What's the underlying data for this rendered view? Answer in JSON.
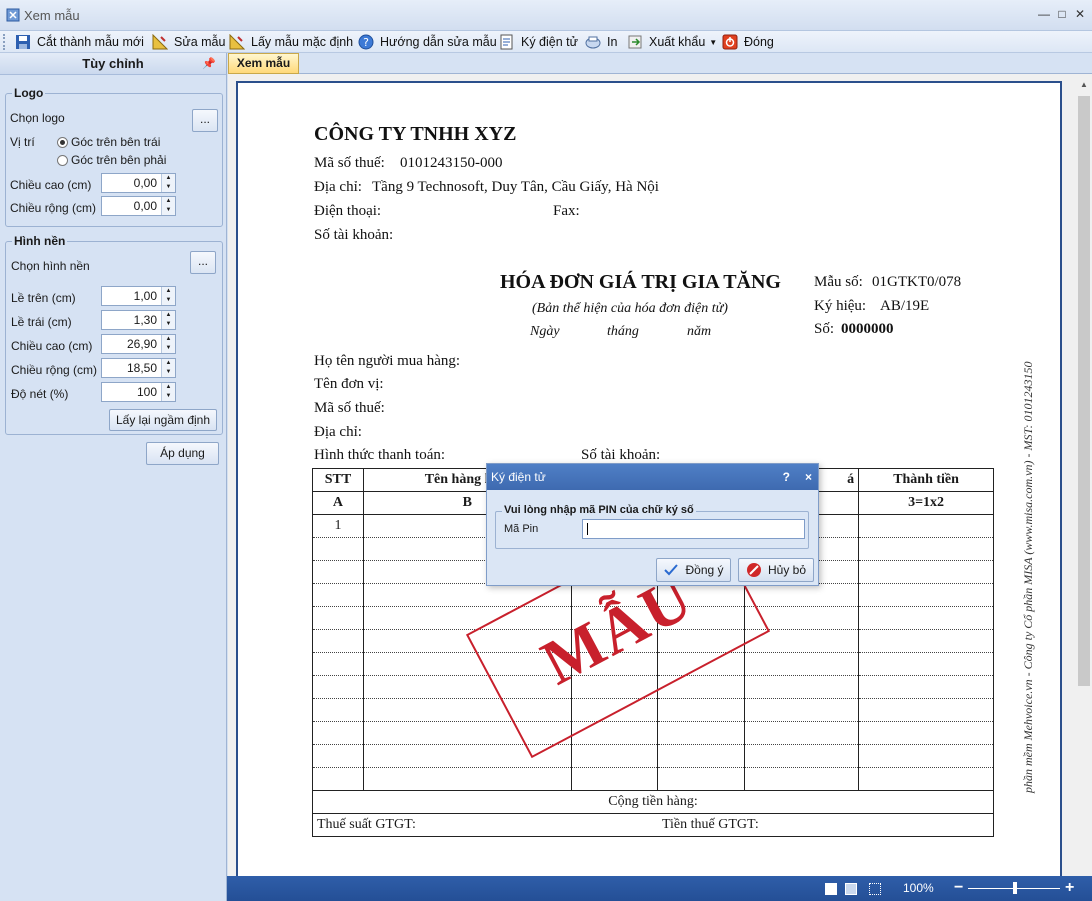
{
  "window": {
    "title": "Xem mẫu"
  },
  "toolbar": {
    "cut_new": "Cắt thành mẫu mới",
    "edit": "Sửa mẫu",
    "default_template": "Lấy mẫu mặc định",
    "help": "Hướng dẫn sửa mẫu",
    "sign": "Ký điện tử",
    "print": "In",
    "export": "Xuất khẩu",
    "close": "Đóng"
  },
  "left_panel": {
    "header": "Tùy chỉnh",
    "logo": {
      "title": "Logo",
      "choose": "Chọn logo",
      "position_label": "Vị trí",
      "pos_top_left": "Góc trên bên trái",
      "pos_top_right": "Góc trên bên phải",
      "height_label": "Chiều cao (cm)",
      "height_value": "0,00",
      "width_label": "Chiều rộng (cm)",
      "width_value": "0,00",
      "ellipsis": "..."
    },
    "background": {
      "title": "Hình nền",
      "choose": "Chọn hình nền",
      "ellipsis": "...",
      "top_margin_label": "Lề trên (cm)",
      "top_margin_value": "1,00",
      "left_margin_label": "Lề trái (cm)",
      "left_margin_value": "1,30",
      "height_label": "Chiều cao (cm)",
      "height_value": "26,90",
      "width_label": "Chiều rộng (cm)",
      "width_value": "18,50",
      "sharpness_label": "Độ nét (%)",
      "sharpness_value": "100",
      "reset": "Lấy lại ngầm định"
    },
    "apply": "Áp dụng"
  },
  "tab": {
    "label": "Xem mẫu"
  },
  "invoice": {
    "company": "CÔNG TY TNHH XYZ",
    "tax_code_label": "Mã số thuế:",
    "tax_code": "0101243150-000",
    "address_label": "Địa chỉ:",
    "address": "Tầng 9 Technosoft, Duy Tân, Cầu Giấy, Hà Nội",
    "phone_label": "Điện thoại:",
    "fax_label": "Fax:",
    "account_label": "Số tài khoản:",
    "title": "HÓA ĐƠN GIÁ TRỊ GIA TĂNG",
    "subtitle": "(Bản thể hiện của hóa đơn điện tử)",
    "date_day": "Ngày",
    "date_month": "tháng",
    "date_year": "năm",
    "form_label": "Mẫu số:",
    "form_value": "01GTKT0/078",
    "symbol_label": "Ký hiệu:",
    "symbol_value": "AB/19E",
    "number_label": "Số:",
    "number_value": "0000000",
    "buyer_label": "Họ tên người mua hàng:",
    "unit_label": "Tên đơn vị:",
    "buyer_tax_label": "Mã số thuế:",
    "buyer_address_label": "Địa chỉ:",
    "payment_label": "Hình thức thanh toán:",
    "buyer_account_label": "Số tài khoản:",
    "col_stt": "STT",
    "col_name": "Tên hàng hóa,",
    "col_price_tail": "á",
    "col_amount": "Thành tiền",
    "sub_a": "A",
    "sub_b": "B",
    "sub_amount": "3=1x2",
    "row1_stt": "1",
    "total_label": "Cộng tiền hàng:",
    "vat_rate_label": "Thuế suất GTGT:",
    "vat_amount_label": "Tiền thuế GTGT:",
    "stamp": "MẪU",
    "side_text": "phần mềm Mehvoice.vn - Công ty Cổ phần MISA (www.misa.com.vn) - MST: 0101243150"
  },
  "dialog": {
    "title": "Ký điện tử",
    "help": "?",
    "close": "×",
    "group_title": "Vui lòng nhập mã PIN của chữ ký số",
    "pin_label": "Mã Pin",
    "ok": "Đồng ý",
    "cancel": "Hủy bỏ"
  },
  "statusbar": {
    "zoom": "100%",
    "minus": "−",
    "plus": "+"
  }
}
